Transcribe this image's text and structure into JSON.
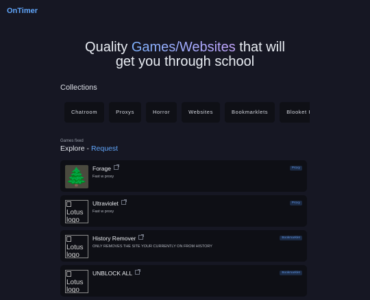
{
  "brand": "OnTimer",
  "hero": {
    "prefix": "Quality ",
    "highlight": "Games/Websites",
    "suffix": " that will",
    "line2": "get you through school",
    "gradient": [
      "#7fb3ff",
      "#c4a6ff"
    ]
  },
  "collections": {
    "title": "Collections",
    "items": [
      "Chatroom",
      "Proxys",
      "Horror",
      "Websites",
      "Bookmarklets",
      "Blooket Hacks"
    ]
  },
  "explore": {
    "caption": "Games fixed",
    "label": "Explore",
    "separator": " - ",
    "link": "Request"
  },
  "games": [
    {
      "title": "Forage",
      "desc": "Fast w proxy",
      "badge": "Proxy",
      "thumb": "🌲",
      "thumb_alt": ""
    },
    {
      "title": "Ultraviolet",
      "desc": "Fast w proxy",
      "badge": "Proxy",
      "thumb": "",
      "thumb_alt": "Lotus logo"
    },
    {
      "title": "History Remover",
      "desc": "ONLY REMOVES THE SITE YOUR CURRENTLY ON FROM HISTORY",
      "badge": "Bookmarklet",
      "thumb": "",
      "thumb_alt": "Lotus logo"
    },
    {
      "title": "UNBLOCK ALL",
      "desc": "",
      "badge": "Bookmarklet",
      "thumb": "",
      "thumb_alt": "Lotus logo"
    }
  ],
  "colors": {
    "background": "#161723",
    "card": "#0e0f15",
    "accent": "#60a5fa"
  }
}
